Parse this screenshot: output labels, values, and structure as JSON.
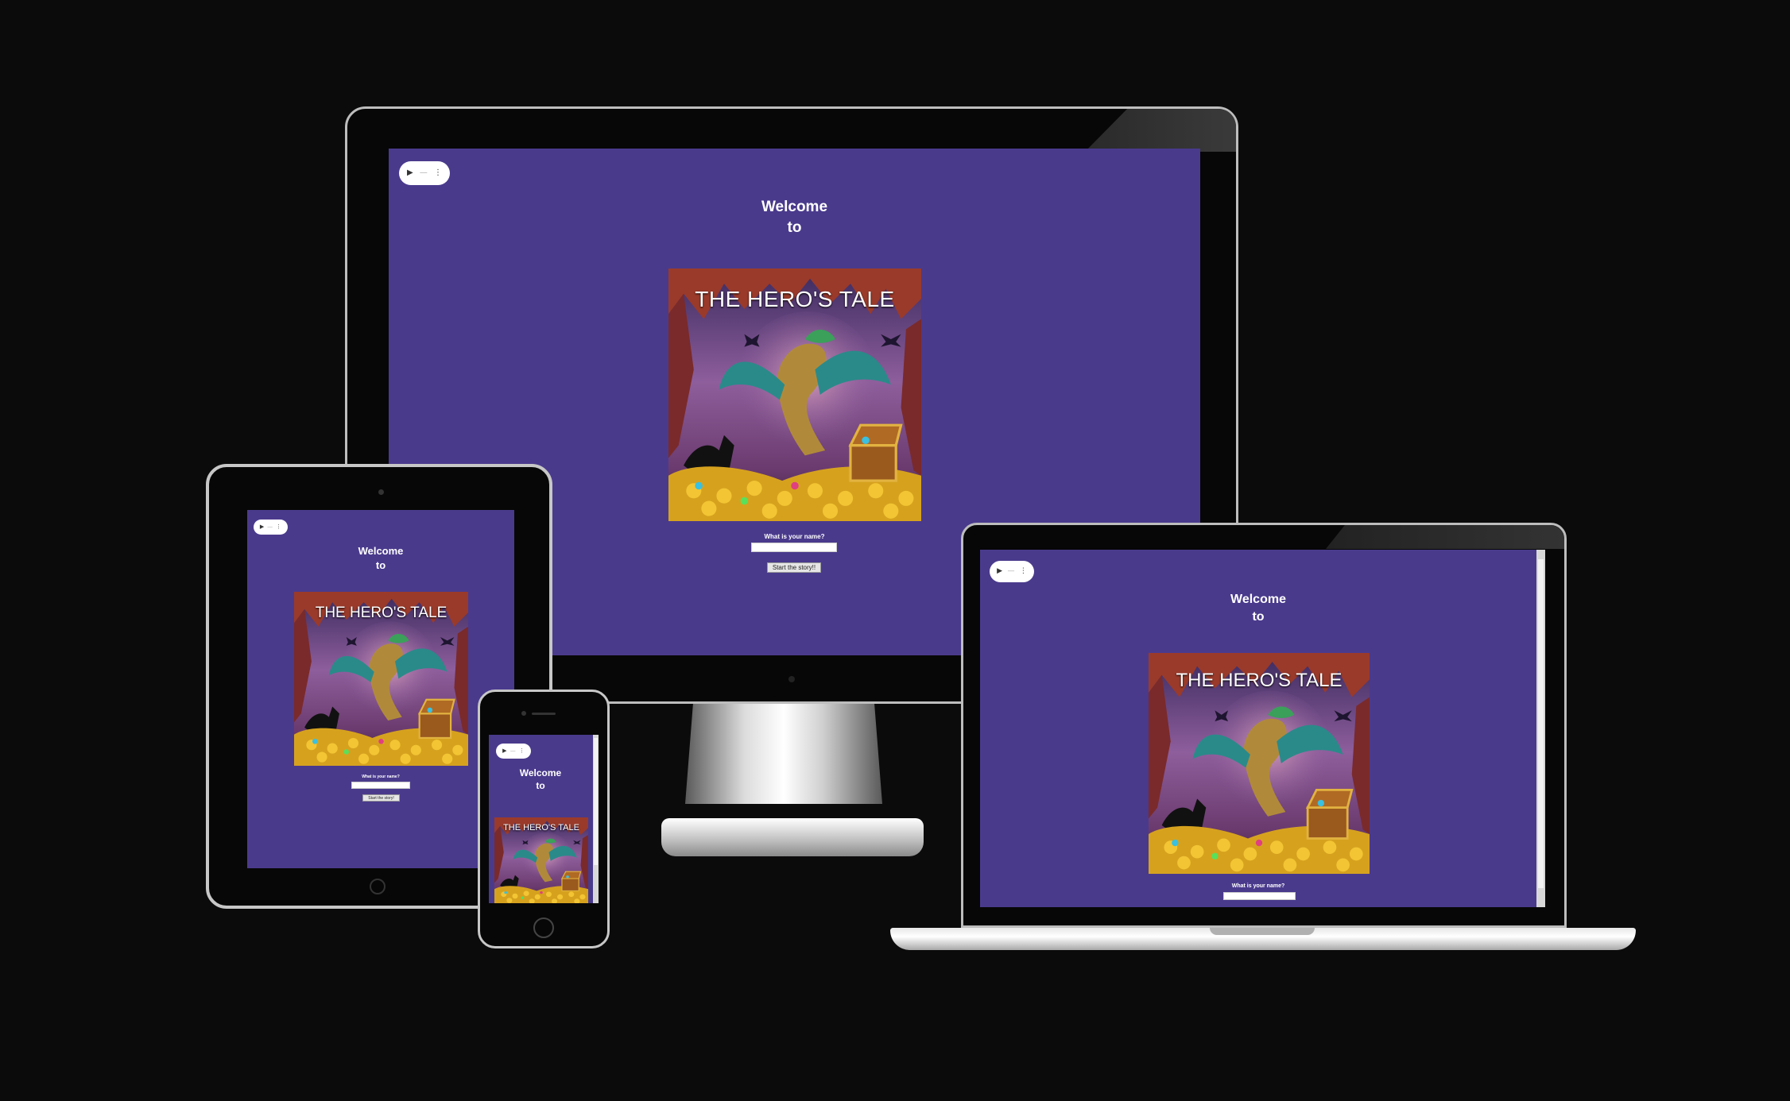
{
  "page": {
    "welcome_line1": "Welcome",
    "welcome_line2": "to",
    "game_title": "THE HERO'S TALE",
    "name_prompt": "What is your name?",
    "name_value": "",
    "start_button": "Start the story!!",
    "start_button_small": "Start the story!"
  },
  "media_controls": {
    "play_icon": "▶",
    "volume_icon": "—",
    "more_icon": "⋮"
  },
  "colors": {
    "page_background": "#4a3a8c",
    "backdrop": "#0c0b0c"
  }
}
